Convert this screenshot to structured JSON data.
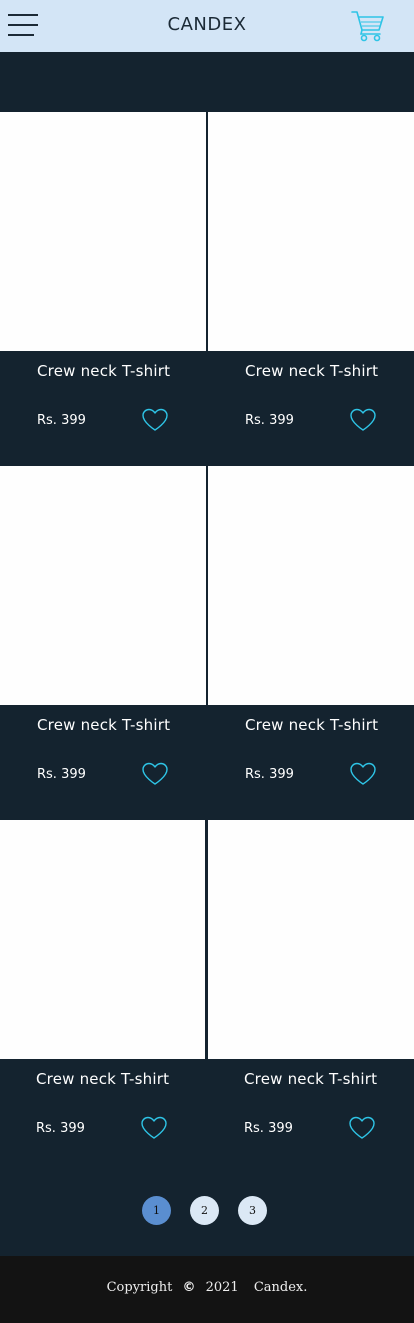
{
  "header": {
    "brand": "CANDEX",
    "menu_icon": "hamburger-icon",
    "cart_icon": "shopping-cart-icon"
  },
  "products": [
    {
      "name": "Crew neck T-shirt",
      "price": "Rs. 399"
    },
    {
      "name": "Crew neck T-shirt",
      "price": "Rs. 399"
    },
    {
      "name": "Crew neck T-shirt",
      "price": "Rs. 399"
    },
    {
      "name": "Crew neck T-shirt",
      "price": "Rs. 399"
    },
    {
      "name": "Crew neck T-shirt",
      "price": "Rs. 399"
    },
    {
      "name": "Crew neck T-shirt",
      "price": "Rs. 399"
    }
  ],
  "pagination": {
    "pages": [
      "1",
      "2",
      "3"
    ],
    "current": "1"
  },
  "footer": {
    "copyright_word": "Copyright",
    "copyright_symbol": "©",
    "year": "2021",
    "company": "Candex."
  },
  "colors": {
    "header_bg": "#d3e5f6",
    "page_bg": "#14232f",
    "accent": "#2ec4e6",
    "active_page": "#5a8ed0",
    "footer_bg": "#131313"
  }
}
